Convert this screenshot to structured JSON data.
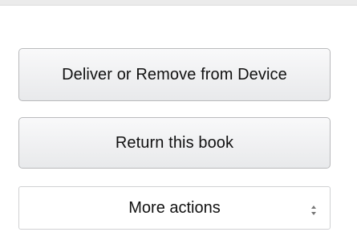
{
  "actions": {
    "deliver_label": "Deliver or Remove from Device",
    "return_label": "Return this book",
    "more_actions": {
      "selected": "More actions",
      "indicator_icon": "up-down-arrows-icon"
    }
  }
}
